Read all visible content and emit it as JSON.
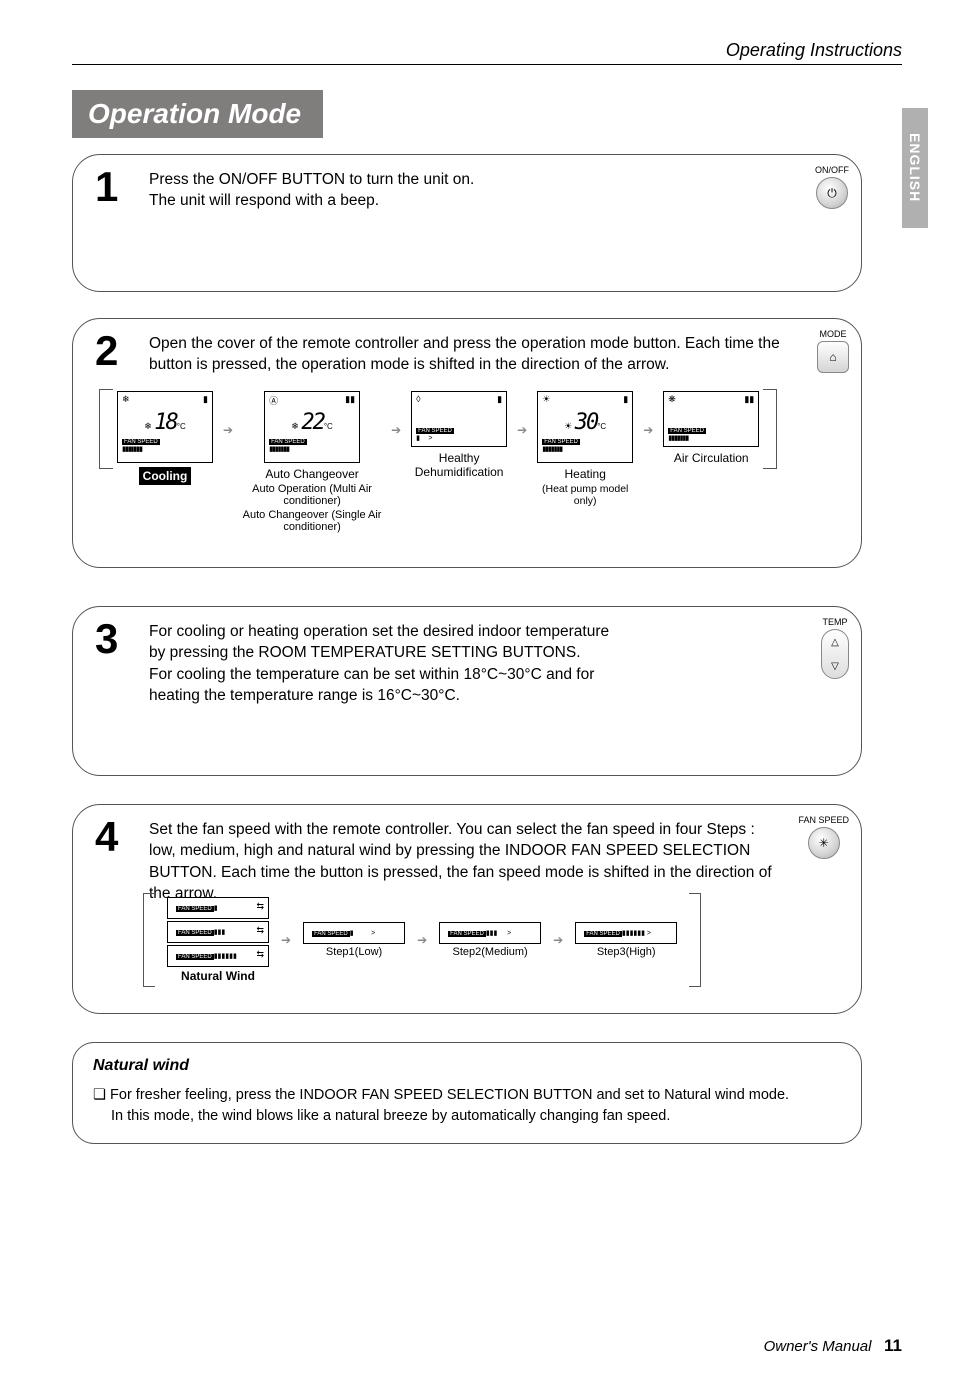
{
  "header": {
    "category": "Operating Instructions"
  },
  "language_tab": "ENGLISH",
  "section_title": "Operation Mode",
  "step1": {
    "num": "1",
    "body": "Press the ON/OFF BUTTON to turn the unit on.\nThe unit will respond with a beep.",
    "button_label": "ON/OFF"
  },
  "step2": {
    "num": "2",
    "body": "Open the cover of the remote controller and press the operation mode button. Each time the button is pressed, the operation mode is shifted in the direction of the arrow.",
    "button_label": "MODE",
    "modes": {
      "cooling": {
        "label": "Cooling",
        "temp": "18",
        "unit": "°C",
        "fan": "FAN SPEED"
      },
      "auto": {
        "label": "Auto Changeover",
        "temp": "22",
        "unit": "°C",
        "sub1": "Auto Operation (Multi Air conditioner)",
        "sub2": "Auto Changeover (Single Air conditioner)"
      },
      "dehum": {
        "label": "Healthy Dehumidification"
      },
      "heating": {
        "label": "Heating",
        "sub": "(Heat pump model only)",
        "temp": "30",
        "unit": "°C"
      },
      "aircirc": {
        "label": "Air Circulation"
      }
    }
  },
  "step3": {
    "num": "3",
    "body": "For cooling or heating operation set the desired indoor temperature by pressing the ROOM TEMPERATURE SETTING BUTTONS.\nFor cooling the temperature can be set within 18°C~30°C and for heating the temperature range is 16°C~30°C.",
    "button_label": "TEMP"
  },
  "step4": {
    "num": "4",
    "body": "Set the fan speed with the remote controller. You can select the fan speed in four Steps : low, medium, high and natural wind by pressing the INDOOR FAN SPEED SELECTION BUTTON. Each time the button is pressed, the fan speed mode is shifted in the direction of the arrow.",
    "button_label": "FAN SPEED",
    "levels": {
      "natural": "Natural Wind",
      "step1": "Step1(Low)",
      "step2": "Step2(Medium)",
      "step3": "Step3(High)"
    },
    "fanspeed_tag": "FAN SPEED"
  },
  "natural": {
    "title": "Natural wind",
    "bullet": "❏",
    "line1": "For fresher feeling, press the INDOOR FAN SPEED SELECTION BUTTON and set to Natural wind mode.",
    "line2": "In this mode, the wind blows like a natural breeze by automatically changing fan speed."
  },
  "footer": {
    "manual": "Owner's Manual",
    "page": "11"
  },
  "icons": {
    "power": "⏻",
    "mode": "⌂",
    "fan": "✳",
    "up": "△",
    "down": "▽",
    "snow": "❄",
    "autoA": "Ⓐ",
    "drop": "◊",
    "sun": "☀",
    "wind": "❋",
    "arrow": "➔",
    "bars": "▮▮▮▮▮▮▮"
  }
}
